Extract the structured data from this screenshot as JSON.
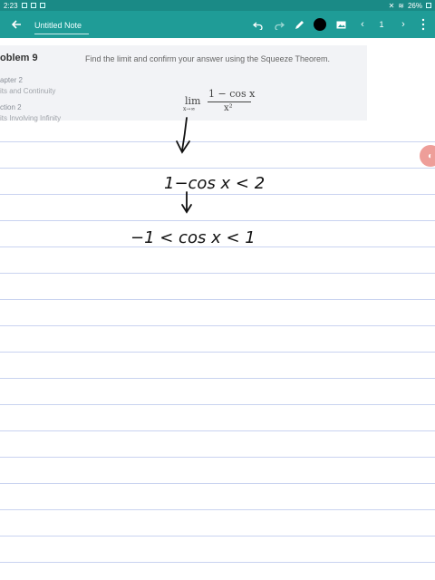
{
  "status_bar": {
    "time": "2:23",
    "battery": "26%"
  },
  "toolbar": {
    "title": "Untitled Note",
    "page_number": "1",
    "color_dot": "#000000"
  },
  "problem": {
    "title": "oblem 9",
    "chapter_label": "apter 2",
    "chapter_name": "its and Continuity",
    "section_label": "ction 2",
    "section_name": "its Involving Infinity",
    "text": "Find the limit and confirm your answer using the Squeeze Theorem.",
    "formula": {
      "lim": "lim",
      "sub": "x→∞",
      "numerator": "1 − cos x",
      "denominator": "x²"
    }
  },
  "handwriting": {
    "line1": "1−cos x < 2",
    "line2": "−1 < cos x < 1"
  },
  "colors": {
    "status": "#1a8a86",
    "toolbar": "#1f9c97",
    "rule": "#c9d3f0",
    "card": "#f2f3f6",
    "accent": "#ee9e99"
  }
}
